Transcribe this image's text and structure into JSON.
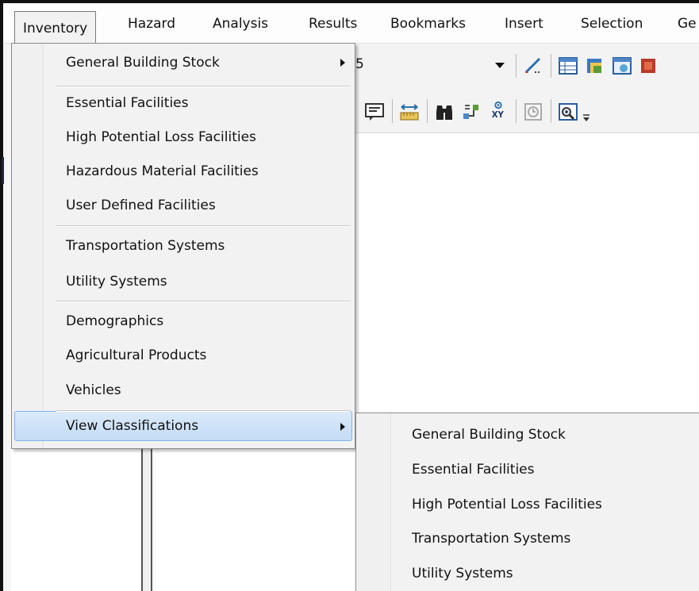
{
  "menubar": {
    "items": [
      "Inventory",
      "Hazard",
      "Analysis",
      "Results",
      "Bookmarks",
      "Insert",
      "Selection",
      "Ge"
    ]
  },
  "toolbar": {
    "combo_value_fragment": "5",
    "icons": [
      "dropdown-arrow-icon",
      "edit-pencil-icon",
      "table-icon",
      "layer-add-icon",
      "window-icon",
      "red-box-icon",
      "message-icon",
      "measure-icon",
      "binoculars-icon",
      "route-icon",
      "xy-locate-icon",
      "time-slider-icon",
      "magnifier-window-icon",
      "toolbar-overflow-icon"
    ],
    "xy_label": "XY"
  },
  "inventory_menu": {
    "items": [
      {
        "label": "General Building Stock",
        "has_submenu": true
      },
      {
        "label": "Essential Facilities"
      },
      {
        "label": "High Potential Loss Facilities"
      },
      {
        "label": "Hazardous Material Facilities"
      },
      {
        "label": "User Defined Facilities"
      },
      {
        "label": "Transportation Systems"
      },
      {
        "label": "Utility Systems"
      },
      {
        "label": "Demographics"
      },
      {
        "label": "Agricultural Products"
      },
      {
        "label": "Vehicles"
      },
      {
        "label": "View Classifications",
        "has_submenu": true,
        "highlighted": true
      }
    ]
  },
  "view_classifications_submenu": {
    "items": [
      {
        "label": "General Building Stock"
      },
      {
        "label": "Essential Facilities"
      },
      {
        "label": "High Potential Loss Facilities"
      },
      {
        "label": "Transportation Systems"
      },
      {
        "label": "Utility Systems"
      }
    ]
  },
  "colors": {
    "highlight": "#c3dcf6",
    "highlight_border": "#7eb4ea",
    "menu_bg": "#f2f2f2"
  }
}
